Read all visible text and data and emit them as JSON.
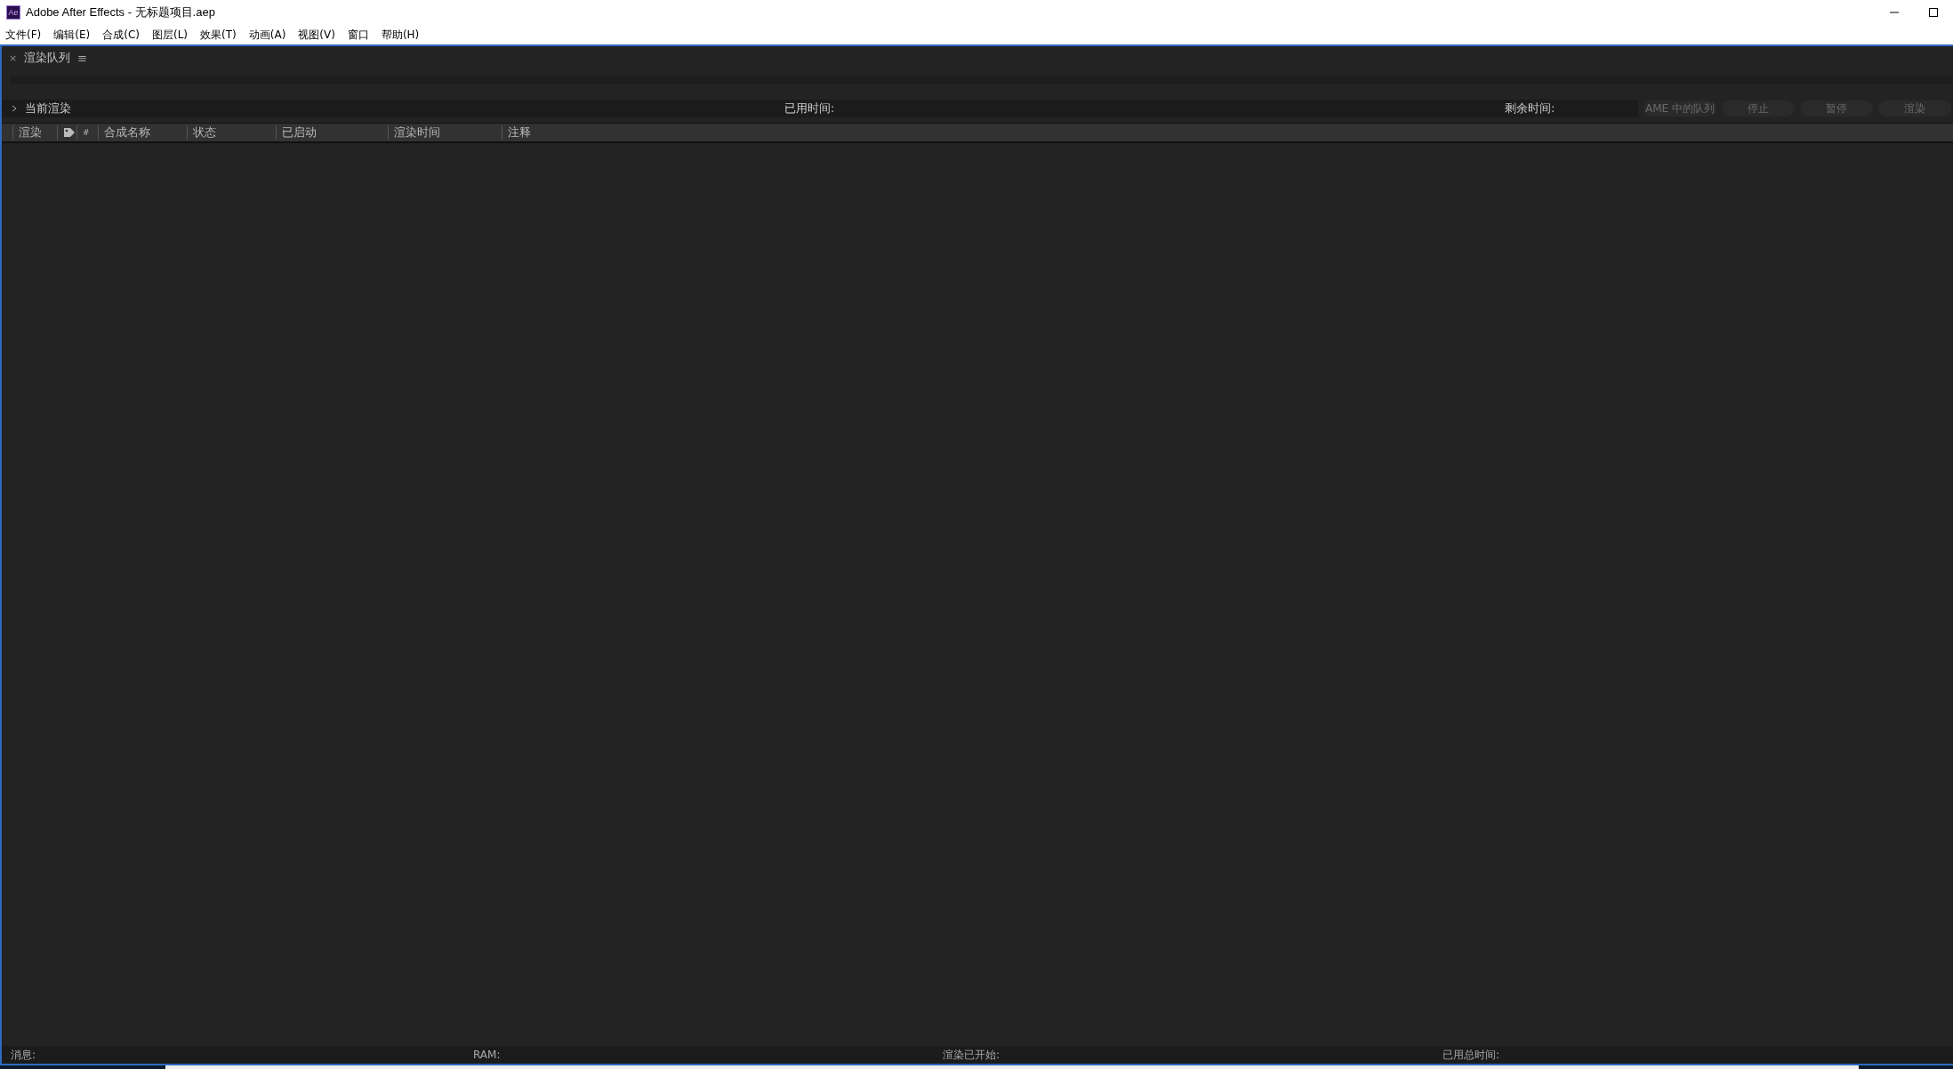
{
  "window": {
    "app_badge": "Ae",
    "title": "Adobe After Effects - 无标题项目.aep"
  },
  "menu": [
    "文件(F)",
    "编辑(E)",
    "合成(C)",
    "图层(L)",
    "效果(T)",
    "动画(A)",
    "视图(V)",
    "窗口",
    "帮助(H)"
  ],
  "panel": {
    "close": "×",
    "title": "渲染队列",
    "menu": "≡"
  },
  "current_render": {
    "expanded": false,
    "label": "当前渲染",
    "elapsed": "已用时间:",
    "remaining": "剩余时间:",
    "buttons": [
      {
        "label": "AME 中的队列",
        "disabled": true
      },
      {
        "label": "停止",
        "disabled": true
      },
      {
        "label": "暂停",
        "disabled": true
      },
      {
        "label": "渲染",
        "disabled": true
      }
    ]
  },
  "table": {
    "columns": [
      {
        "kind": "text",
        "label": "渲染"
      },
      {
        "kind": "tag"
      },
      {
        "kind": "text",
        "label": "#"
      },
      {
        "kind": "text",
        "label": "合成名称"
      },
      {
        "kind": "text",
        "label": "状态"
      },
      {
        "kind": "text",
        "label": "已启动"
      },
      {
        "kind": "text",
        "label": "渲染时间"
      },
      {
        "kind": "text",
        "label": "注释"
      }
    ]
  },
  "status_bar": [
    "消息:",
    "RAM:",
    "渲染已开始:",
    "已用总时间:"
  ]
}
